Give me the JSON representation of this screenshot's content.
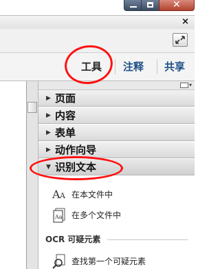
{
  "window": {
    "controls": {
      "minimize_icon": "minimize-icon",
      "maximize_icon": "maximize-icon",
      "close_icon": "close-icon"
    },
    "document_close": "×"
  },
  "tabs": [
    {
      "label": "工具",
      "active": true
    },
    {
      "label": "注释",
      "active": false
    },
    {
      "label": "共享",
      "active": false
    }
  ],
  "panel": {
    "sections": [
      {
        "label": "页面",
        "expanded": false
      },
      {
        "label": "内容",
        "expanded": false
      },
      {
        "label": "表单",
        "expanded": false
      },
      {
        "label": "动作向导",
        "expanded": false
      },
      {
        "label": "识别文本",
        "expanded": true
      }
    ],
    "ocr_tools": [
      {
        "label": "在本文件中",
        "icon": "text-aa-icon"
      },
      {
        "label": "在多个文件中",
        "icon": "multi-file-icon"
      }
    ],
    "ocr_suspects": {
      "heading": "OCR 可疑元素",
      "items": [
        {
          "label": "查找第一个可疑元素",
          "icon": "find-suspect-icon"
        }
      ]
    }
  },
  "annotations": {
    "ring_color": "#ff1010"
  },
  "colors": {
    "tab_link": "#1d4f86",
    "tab_active": "#222222"
  }
}
